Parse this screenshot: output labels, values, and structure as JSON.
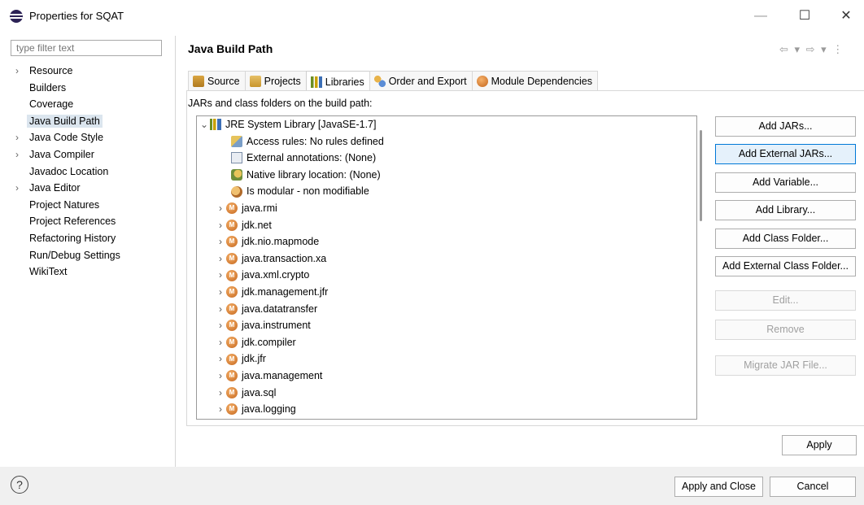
{
  "window": {
    "title": "Properties for SQAT",
    "minimize_glyph": "—",
    "maximize_glyph": "☐",
    "close_glyph": "✕"
  },
  "filter": {
    "placeholder": "type filter text",
    "value": ""
  },
  "nav": {
    "items": [
      {
        "label": "Resource",
        "expandable": true
      },
      {
        "label": "Builders",
        "expandable": false
      },
      {
        "label": "Coverage",
        "expandable": false
      },
      {
        "label": "Java Build Path",
        "expandable": false,
        "selected": true
      },
      {
        "label": "Java Code Style",
        "expandable": true
      },
      {
        "label": "Java Compiler",
        "expandable": true
      },
      {
        "label": "Javadoc Location",
        "expandable": false
      },
      {
        "label": "Java Editor",
        "expandable": true
      },
      {
        "label": "Project Natures",
        "expandable": false
      },
      {
        "label": "Project References",
        "expandable": false
      },
      {
        "label": "Refactoring History",
        "expandable": false
      },
      {
        "label": "Run/Debug Settings",
        "expandable": false
      },
      {
        "label": "WikiText",
        "expandable": false
      }
    ]
  },
  "page": {
    "title": "Java Build Path",
    "nav_arrows": "⇦ ▾ ⇨ ▾ ⋮"
  },
  "tabs": [
    {
      "label": "Source",
      "icon": "source-folder-icon"
    },
    {
      "label": "Projects",
      "icon": "projects-folder-icon"
    },
    {
      "label": "Libraries",
      "icon": "libraries-icon",
      "active": true
    },
    {
      "label": "Order and Export",
      "icon": "order-export-icon"
    },
    {
      "label": "Module Dependencies",
      "icon": "module-icon"
    }
  ],
  "libraries": {
    "label": "JARs and class folders on the build path:",
    "root": {
      "label": "JRE System Library [JavaSE-1.7]",
      "icon": "library-icon"
    },
    "details": [
      {
        "label": "Access rules: No rules defined",
        "icon": "access-rules-icon"
      },
      {
        "label": "External annotations: (None)",
        "icon": "annotations-icon"
      },
      {
        "label": "Native library location: (None)",
        "icon": "native-library-icon"
      },
      {
        "label": "Is modular - non modifiable",
        "icon": "modular-icon"
      }
    ],
    "modules": [
      "java.rmi",
      "jdk.net",
      "jdk.nio.mapmode",
      "java.transaction.xa",
      "java.xml.crypto",
      "jdk.management.jfr",
      "java.datatransfer",
      "java.instrument",
      "jdk.compiler",
      "jdk.jfr",
      "java.management",
      "java.sql",
      "java.logging"
    ]
  },
  "buttons": {
    "add_jars": "Add JARs...",
    "add_external_jars": "Add External JARs...",
    "add_variable": "Add Variable...",
    "add_library": "Add Library...",
    "add_class_folder": "Add Class Folder...",
    "add_external_class_folder": "Add External Class Folder...",
    "edit": "Edit...",
    "remove": "Remove",
    "migrate_jar": "Migrate JAR File...",
    "apply": "Apply",
    "apply_and_close": "Apply and Close",
    "cancel": "Cancel"
  },
  "help": {
    "glyph": "?"
  },
  "colors": {
    "selection": "#dbe5ee",
    "focus_border": "#0078d7",
    "bottom_bar": "#f0f0f0"
  }
}
